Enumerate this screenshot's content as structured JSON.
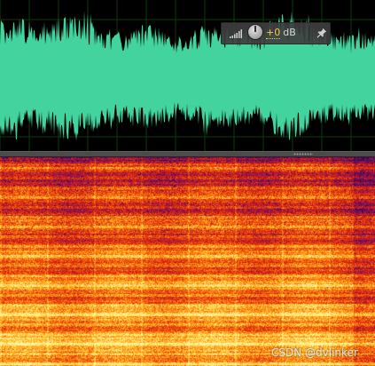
{
  "hud": {
    "gain_value": "+0",
    "gain_unit": "dB",
    "icons": {
      "meter": "level-meter-icon",
      "knob": "volume-knob-icon",
      "pin": "pin-icon"
    }
  },
  "waveform": {
    "fill_color": "#43d39e",
    "background_color": "#000000",
    "grid_color": "#0b3b0b"
  },
  "spectrogram": {
    "palette": [
      "#2b0a4a",
      "#6a0f6e",
      "#b0122e",
      "#dc2a0c",
      "#f05a0c",
      "#ff9a18",
      "#ffd23c",
      "#fff3a0"
    ]
  },
  "watermark": {
    "text": "CSDN @dvlinker"
  }
}
